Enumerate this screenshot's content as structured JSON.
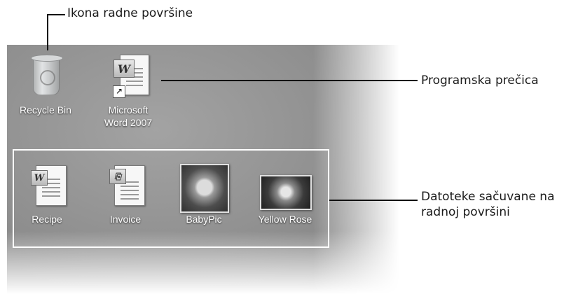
{
  "callouts": {
    "desktop_icon": "Ikona radne površine",
    "program_shortcut": "Programska prečica",
    "saved_files_line1": "Datoteke sačuvane na",
    "saved_files_line2": "radnoj površini"
  },
  "desktop": {
    "icons": [
      {
        "label": "Recycle Bin",
        "icon": "recycle-bin-icon"
      },
      {
        "label_line1": "Microsoft",
        "label_line2": "Word 2007",
        "icon": "word-shortcut-icon"
      }
    ],
    "files": [
      {
        "label": "Recipe",
        "icon": "word-document-icon"
      },
      {
        "label": "Invoice",
        "icon": "document-icon"
      },
      {
        "label": "BabyPic",
        "icon": "photo-icon"
      },
      {
        "label": "Yellow Rose",
        "icon": "photo-icon"
      }
    ]
  },
  "colors": {
    "desktop_background": "#8f8f8f",
    "label_text": "#ffffff",
    "callout_text": "#1b1b1b"
  }
}
